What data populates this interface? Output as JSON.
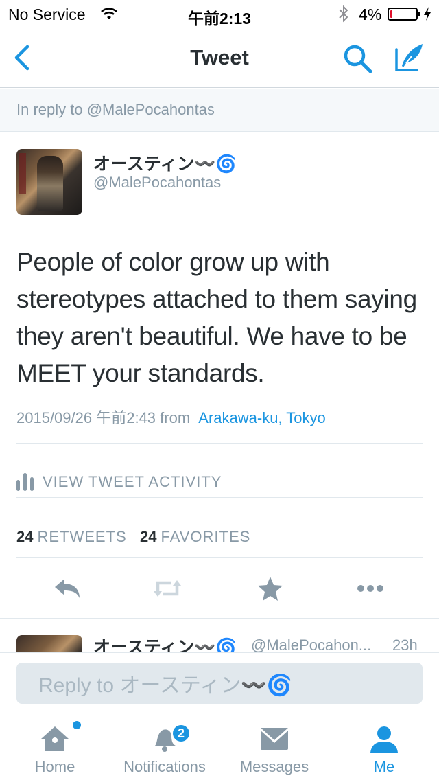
{
  "status_bar": {
    "carrier": "No Service",
    "time": "午前2:13",
    "battery_percent": "4%",
    "battery_level": 0.04,
    "battery_color": "#e0112b"
  },
  "nav": {
    "title": "Tweet",
    "back_icon": "chevron-left-icon",
    "search_icon": "search-icon",
    "compose_icon": "compose-icon"
  },
  "reply_context": {
    "text": "In reply to @MalePocahontas"
  },
  "tweet": {
    "display_name": "オースティン〰️🌀",
    "screen_name": "@MalePocahontas",
    "text": "People of color grow up with stereotypes attached to them saying they aren't beautiful. We have to be MEET your standards.",
    "timestamp": "2015/09/26 午前2:43",
    "from_label": "from",
    "location": "Arakawa-ku, Tokyo",
    "activity_label": "VIEW TWEET ACTIVITY",
    "retweets_count": "24",
    "retweets_label": "RETWEETS",
    "favorites_count": "24",
    "favorites_label": "FAVORITES",
    "actions": [
      "reply-icon",
      "retweet-icon",
      "favorite-icon",
      "more-icon"
    ]
  },
  "next_tweet": {
    "display_name": "オースティン〰️🌀",
    "screen_name": "@MalePocahon...",
    "time": "23h"
  },
  "reply_bar": {
    "placeholder": "Reply to オースティン〰️🌀"
  },
  "tab_bar": {
    "tabs": [
      {
        "label": "Home",
        "icon": "home-icon"
      },
      {
        "label": "Notifications",
        "icon": "bell-icon",
        "badge": "2"
      },
      {
        "label": "Messages",
        "icon": "envelope-icon"
      },
      {
        "label": "Me",
        "icon": "person-icon",
        "active": true
      }
    ]
  },
  "colors": {
    "accent": "#1b95e0",
    "muted": "#8899a6",
    "text": "#292f33",
    "light_bg": "#f5f8fa"
  }
}
